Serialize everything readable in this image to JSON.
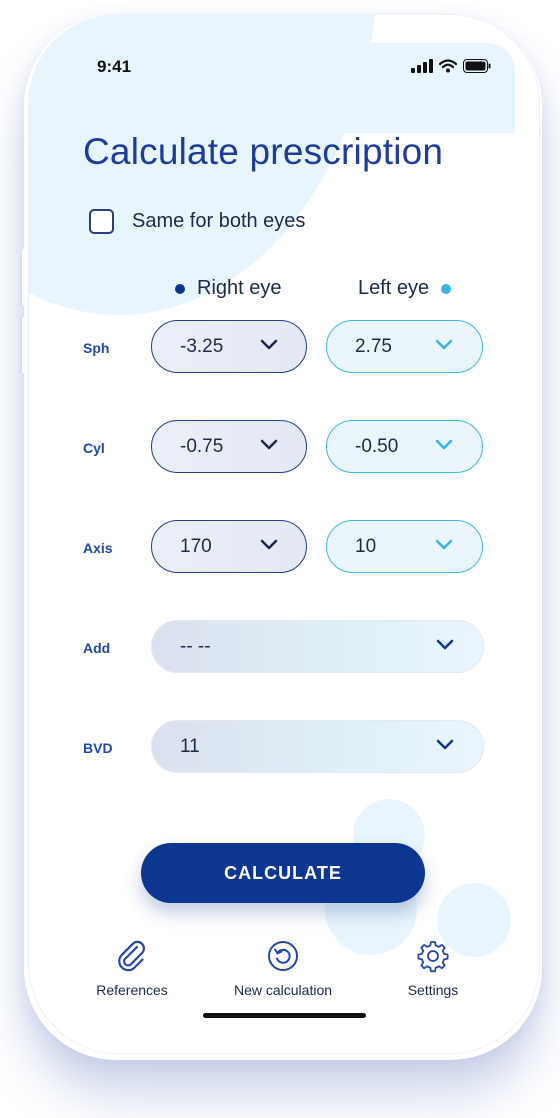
{
  "status_bar": {
    "time": "9:41"
  },
  "title": "Calculate prescription",
  "same_for_both": {
    "label": "Same for both eyes",
    "checked": false
  },
  "eyes": {
    "right": {
      "label": "Right eye",
      "color": "#0d3691"
    },
    "left": {
      "label": "Left eye",
      "color": "#35b3ea"
    }
  },
  "rows": {
    "sph": {
      "label": "Sph",
      "right": "-3.25",
      "left": "2.75"
    },
    "cyl": {
      "label": "Cyl",
      "right": "-0.75",
      "left": "-0.50"
    },
    "axis": {
      "label": "Axis",
      "right": "170",
      "left": "10"
    },
    "add": {
      "label": "Add",
      "value": "-- --"
    },
    "bvd": {
      "label": "BVD",
      "value": "11"
    }
  },
  "calculate_button": "CALCULATE",
  "nav": {
    "references": {
      "label": "References",
      "icon": "paperclip-icon"
    },
    "new_calculation": {
      "label": "New calculation",
      "icon": "refresh-icon"
    },
    "settings": {
      "label": "Settings",
      "icon": "gear-icon"
    }
  },
  "colors": {
    "primary": "#0d3691",
    "accent": "#35b3ea",
    "title": "#1e3d9a"
  }
}
